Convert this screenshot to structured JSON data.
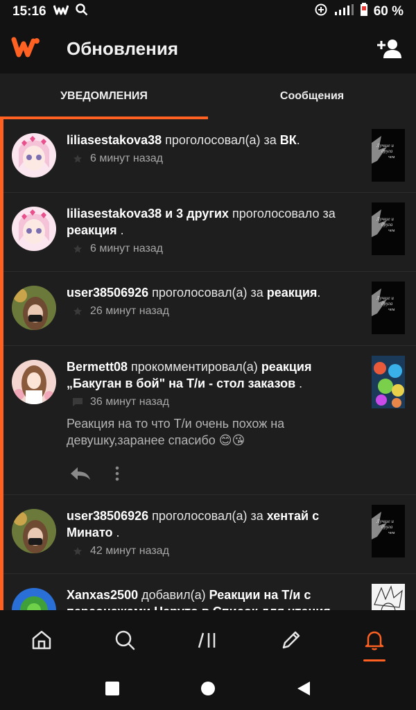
{
  "status_bar": {
    "time": "15:16",
    "battery": "60 %",
    "icons": [
      "wattpad-icon",
      "search-icon",
      "data-saver-icon",
      "signal-icon",
      "battery-icon"
    ]
  },
  "app_bar": {
    "title": "Обновления"
  },
  "tabs": [
    {
      "label": "УВЕДОМЛЕНИЯ",
      "active": true
    },
    {
      "label": "Сообщения",
      "active": false
    }
  ],
  "notifications": [
    {
      "user": "liliasestakova38",
      "action": " проголосовал(а) за ",
      "target": "ВК",
      "suffix": ".",
      "time": "6 минут назад"
    },
    {
      "user": "liliasestakova38 и 3 других",
      "action": " проголосовало за ",
      "target": "реакция",
      "suffix": " .",
      "time": "6 минут назад"
    },
    {
      "user": "user38506926",
      "action": " проголосовал(а) за ",
      "target": "реакция",
      "suffix": ".",
      "time": "26 минут назад"
    },
    {
      "user": "Bermett08",
      "action": " прокомментировал(а) ",
      "target": "реакция „Бакуган в бой\" на Т/и - стол заказов",
      "suffix": " .",
      "time": "36 минут назад",
      "comment": "Реакция на то что Т/и очень похож на девушку,заранее спасибо 😊😘"
    },
    {
      "user": "user38506926",
      "action": " проголосовал(а) за ",
      "target": "хентай с Минато",
      "suffix": " .",
      "time": "42 минут назад"
    },
    {
      "user": "Xanxas2500",
      "action": " добавил(а) ",
      "target": "Реакции на Т/и с персонажами Наруто в Список для чтения",
      "suffix": ""
    }
  ],
  "thumb_text": "Лучше и друга чем учих",
  "colors": {
    "accent": "#ff6122",
    "background": "#121212",
    "surface": "#1e1e1e"
  }
}
